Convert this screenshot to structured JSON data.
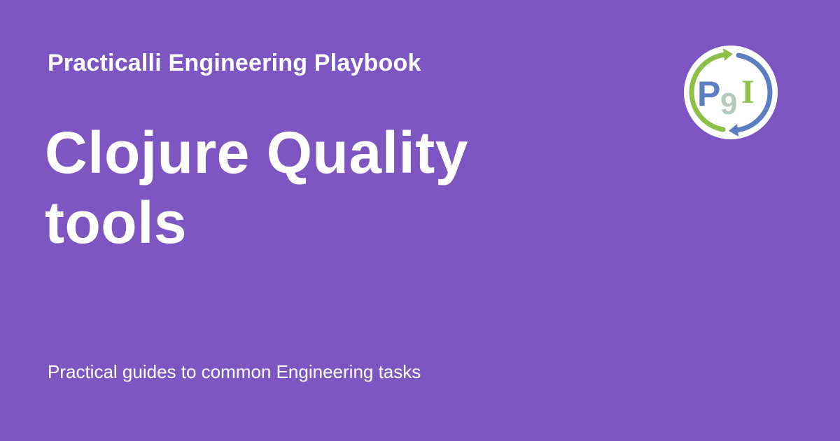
{
  "site": {
    "name": "Practicalli Engineering Playbook"
  },
  "page": {
    "title_lines": [
      "Clojure Quality",
      "tools"
    ],
    "tagline": "Practical guides to common Engineering tasks"
  },
  "logo": {
    "icon": "practicalli-logo-icon",
    "text": "P9I",
    "colors": {
      "green": "#8cc04a",
      "blue": "#5b7ec2",
      "grey": "#b7c8bc",
      "background": "#ffffff"
    }
  },
  "colors": {
    "background": "#7e56c2",
    "text": "#ffffff"
  }
}
